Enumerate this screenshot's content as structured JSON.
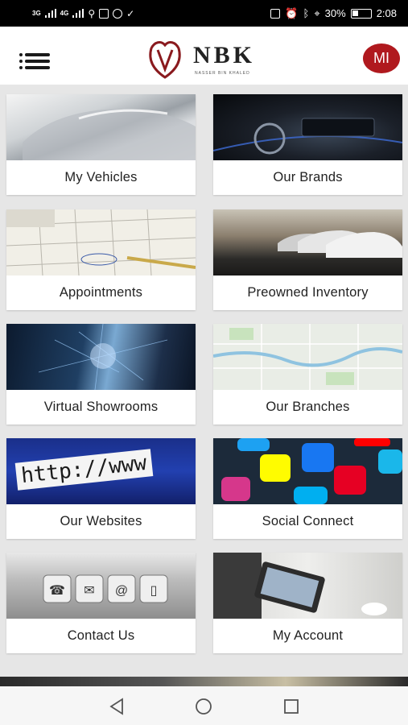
{
  "status_bar": {
    "network_1": "3G",
    "network_2": "4G",
    "battery_percent": "30%",
    "time": "2:08"
  },
  "header": {
    "logo_text": "NBK",
    "logo_sub": "NASSER BIN KHALED",
    "avatar_initials": "MI",
    "brand_color": "#b0191e"
  },
  "tiles": [
    {
      "label": "My Vehicles"
    },
    {
      "label": "Our Brands"
    },
    {
      "label": "Appointments"
    },
    {
      "label": "Preowned Inventory"
    },
    {
      "label": "Virtual Showrooms"
    },
    {
      "label": "Our Branches"
    },
    {
      "label": "Our Websites"
    },
    {
      "label": "Social Connect"
    },
    {
      "label": "Contact Us"
    },
    {
      "label": "My Account"
    }
  ],
  "websites_image_text": "http://www",
  "icons": {
    "menu": "hamburger-icon",
    "back": "back-triangle-icon",
    "home": "home-circle-icon",
    "recents": "recents-square-icon"
  }
}
